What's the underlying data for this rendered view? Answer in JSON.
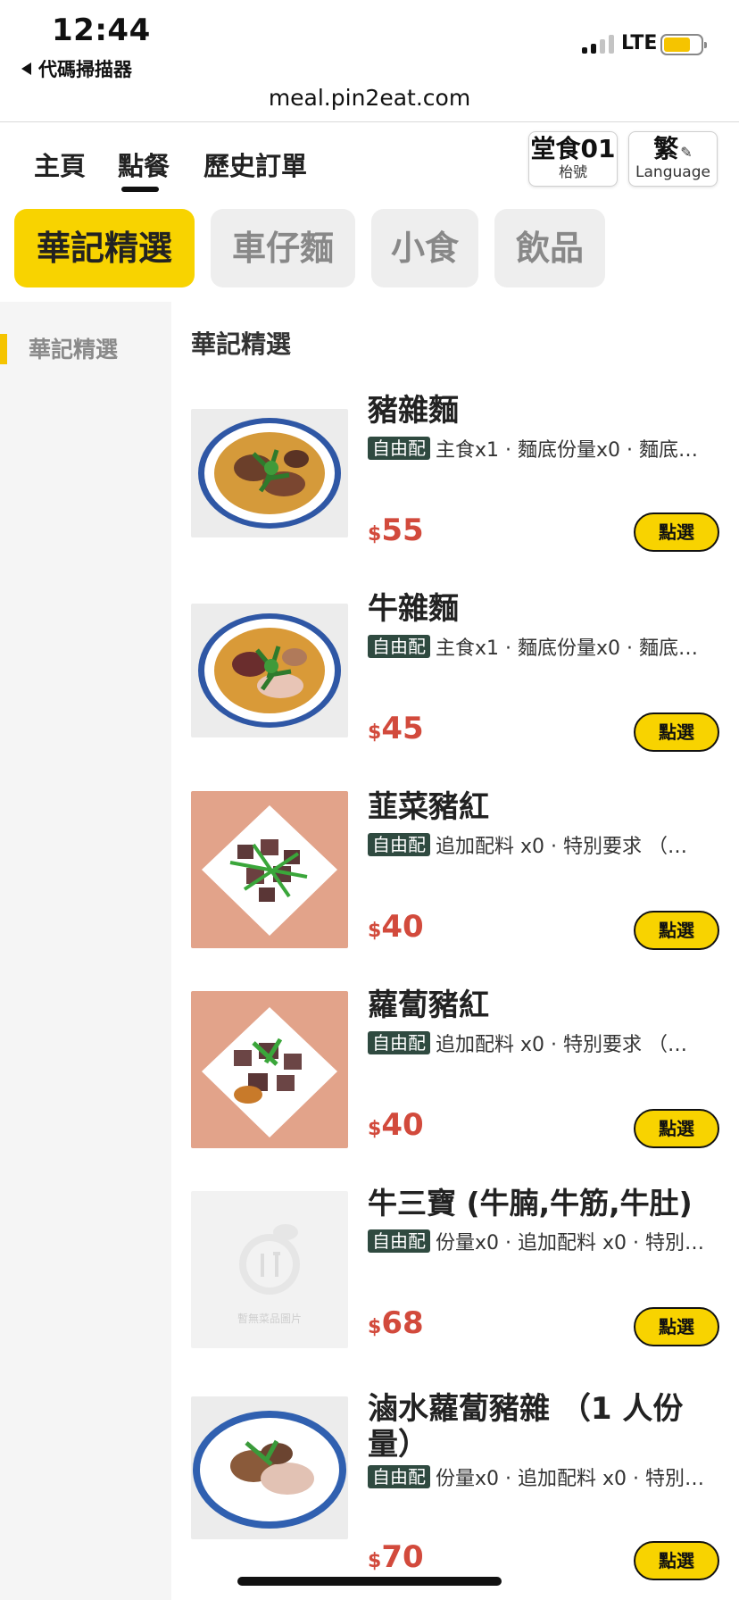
{
  "status_bar": {
    "time": "12:44",
    "back_label": "代碼掃描器",
    "network": "LTE",
    "battery_level_percent": 72
  },
  "browser": {
    "url": "meal.pin2eat.com"
  },
  "nav": {
    "tabs": [
      "主頁",
      "點餐",
      "歷史訂單"
    ],
    "active_tab": "點餐",
    "table": {
      "label": "堂食01",
      "sub": "枱號"
    },
    "language": {
      "label": "繁",
      "sub": "Language"
    }
  },
  "categories": {
    "chips": [
      "華記精選",
      "車仔麵",
      "小食",
      "飲品"
    ],
    "active": "華記精選"
  },
  "sidebar": {
    "items": [
      "華記精選"
    ]
  },
  "menu": {
    "section_title": "華記精選",
    "badge": "自由配",
    "button_label": "點選",
    "currency": "$",
    "placeholder_caption": "暫無菜品圖片",
    "items": [
      {
        "name": "豬雜麵",
        "desc": "主食x1 · 麵底份量x0 · 麵底…",
        "price": "55"
      },
      {
        "name": "牛雜麵",
        "desc": "主食x1 · 麵底份量x0 · 麵底…",
        "price": "45"
      },
      {
        "name": "韮菜豬紅",
        "desc": "追加配料 x0 · 特別要求 （…",
        "price": "40"
      },
      {
        "name": "蘿蔔豬紅",
        "desc": "追加配料 x0 · 特別要求 （…",
        "price": "40"
      },
      {
        "name": "牛三寶 (牛腩,牛筋,牛肚)",
        "desc": "份量x0 · 追加配料 x0 · 特別…",
        "price": "68"
      },
      {
        "name": "滷水蘿蔔豬雜 （1 人份量）",
        "desc": "份量x0 · 追加配料 x0 · 特別…",
        "price": "70"
      }
    ]
  },
  "colors": {
    "accent_yellow": "#f8d300",
    "price_red": "#d24a3c",
    "badge_green": "#2f4a40"
  }
}
